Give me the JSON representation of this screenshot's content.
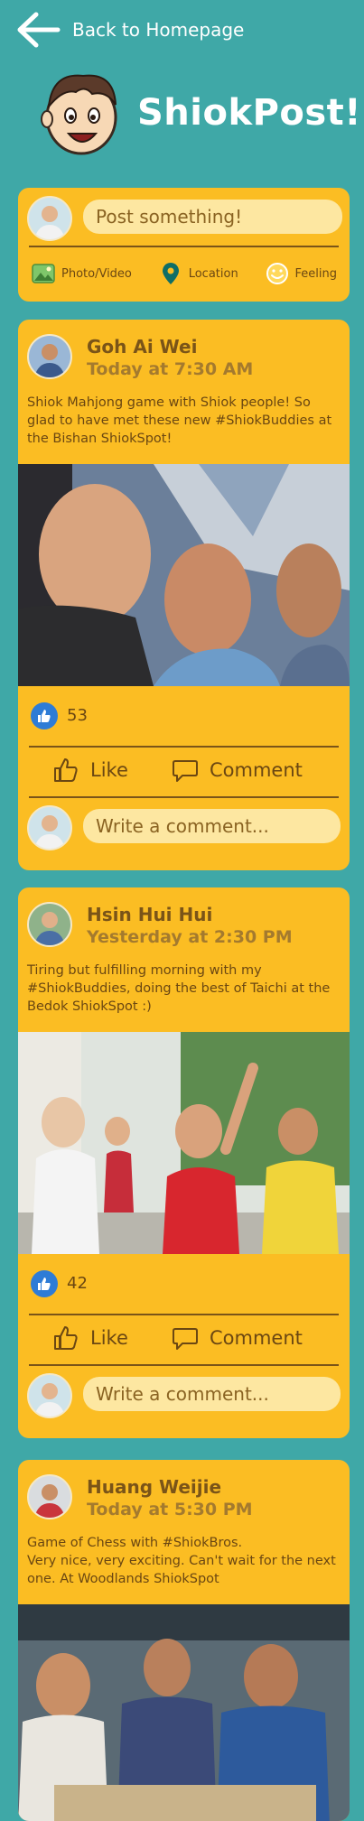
{
  "header": {
    "back_label": "Back to Homepage",
    "brand": "ShiokPost!"
  },
  "composer": {
    "placeholder": "Post something!",
    "actions": [
      {
        "label": "Photo/Video",
        "icon": "photo-icon"
      },
      {
        "label": "Location",
        "icon": "location-pin-icon"
      },
      {
        "label": "Feeling",
        "icon": "smiley-icon"
      }
    ]
  },
  "posts": [
    {
      "author": "Goh Ai Wei",
      "time": "Today at 7:30 AM",
      "text": "Shiok Mahjong game with Shiok people! So glad to have met these new #ShiokBuddies at the Bishan ShiokSpot!",
      "likes": "53",
      "like_label": "Like",
      "comment_label": "Comment",
      "comment_placeholder": "Write a comment..."
    },
    {
      "author": "Hsin Hui Hui",
      "time": "Yesterday at 2:30 PM",
      "text": "Tiring but fulfilling morning with my #ShiokBuddies, doing the best of Taichi at the Bedok ShiokSpot :)",
      "likes": "42",
      "like_label": "Like",
      "comment_label": "Comment",
      "comment_placeholder": "Write a comment..."
    },
    {
      "author": "Huang Weijie",
      "time": "Today at 5:30 PM",
      "text": "Game of Chess with #ShiokBros.\nVery nice, very exciting. Can't wait for the next one. At Woodlands ShiokSpot"
    }
  ],
  "colors": {
    "background": "#3fa8a7",
    "card": "#fbbd23",
    "pill": "#fde7a1",
    "text_brown": "#7a5418",
    "like_blue": "#2e7cd6"
  }
}
